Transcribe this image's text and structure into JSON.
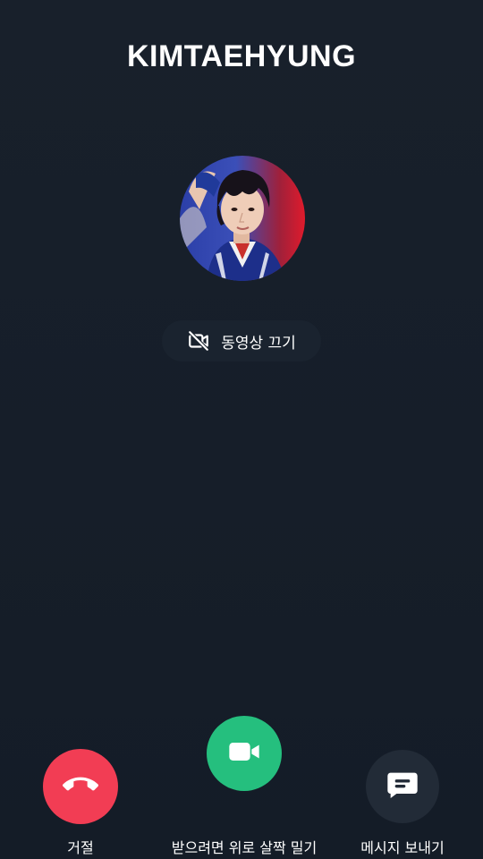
{
  "caller": {
    "name": "KIMTAEHYUNG"
  },
  "video_toggle": {
    "label": "동영상 끄기",
    "icon": "video-off-icon"
  },
  "actions": {
    "decline_label": "거절",
    "accept_label": "받으려면 위로 살짝 밀기",
    "message_label": "메시지 보내기"
  },
  "colors": {
    "background": "#171f2a",
    "decline": "#f23d54",
    "accept": "#25bf7e",
    "message": "#222b37"
  }
}
